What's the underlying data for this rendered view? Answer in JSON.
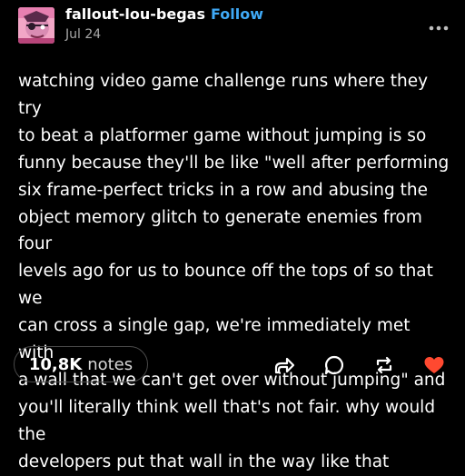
{
  "post": {
    "author": "fallout-lou-begas",
    "follow_label": "Follow",
    "date": "Jul 24",
    "body": "watching video game challenge runs where they try\nto beat a platformer game without jumping is so\nfunny because they'll be like \"well after performing\nsix frame-perfect tricks in a row and abusing the\nobject memory glitch to generate enemies from four\nlevels ago for us to bounce off the tops of so that we\ncan cross a single gap, we're immediately met with\na wall that we can't get over without jumping\" and\nyou'll literally think well that's not fair. why would the\ndevelopers put that wall in the way like that"
  },
  "footer": {
    "notes_count": "10,8K",
    "notes_label": "notes",
    "actions": [
      "share-icon",
      "reply-icon",
      "reblog-icon",
      "like-icon"
    ]
  },
  "colors": {
    "background": "#000000",
    "text": "#ffffff",
    "follow": "#3fa9f5",
    "muted": "#a8a8a8",
    "like": "#ff4930"
  }
}
